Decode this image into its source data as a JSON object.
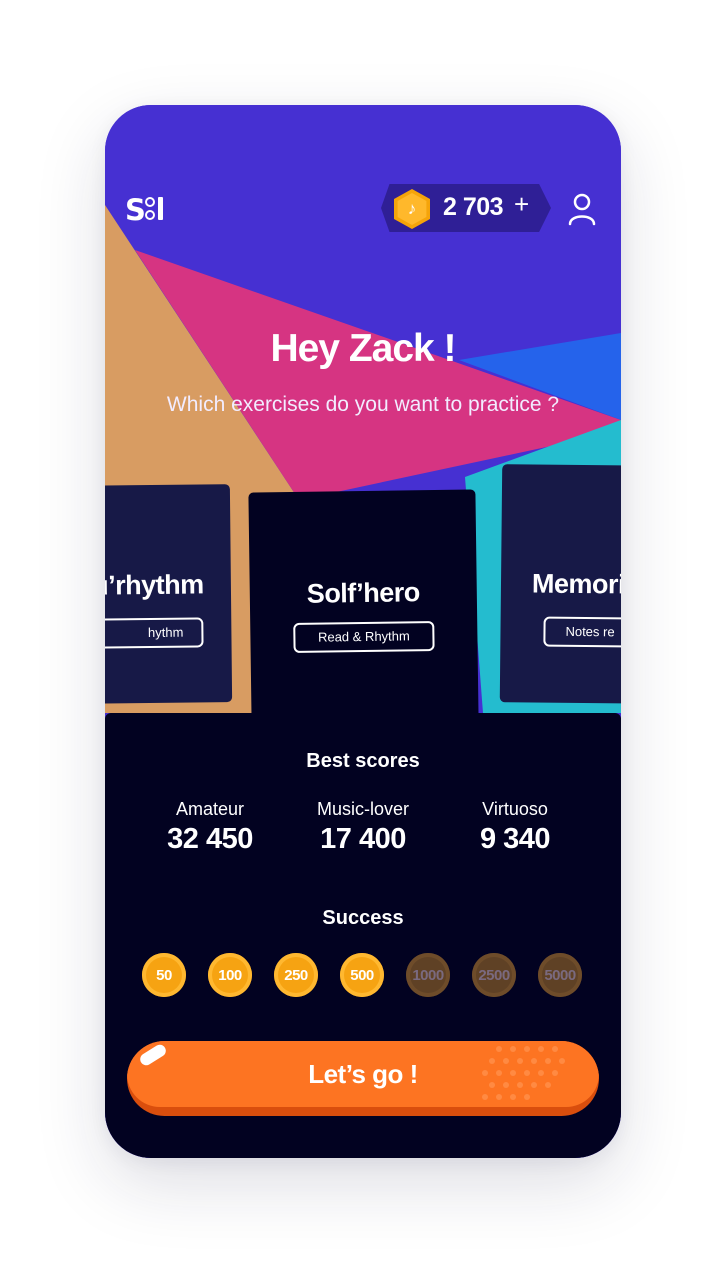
{
  "header": {
    "logo_text": "S",
    "coins": "2 703",
    "add_symbol": "+"
  },
  "greeting": "Hey Zack !",
  "subtitle": "Which exercises do you want to practice ?",
  "cards": [
    {
      "title": "ou’rhythm",
      "tag": "hythm"
    },
    {
      "title": "Solf’hero",
      "tag": "Read & Rhythm"
    },
    {
      "title": "Memori",
      "tag": "Notes re"
    }
  ],
  "best_scores": {
    "title": "Best scores",
    "items": [
      {
        "label": "Amateur",
        "value": "32 450"
      },
      {
        "label": "Music-lover",
        "value": "17 400"
      },
      {
        "label": "Virtuoso",
        "value": "9 340"
      }
    ]
  },
  "success": {
    "title": "Success",
    "badges": [
      {
        "label": "50",
        "unlocked": true
      },
      {
        "label": "100",
        "unlocked": true
      },
      {
        "label": "250",
        "unlocked": true
      },
      {
        "label": "500",
        "unlocked": true
      },
      {
        "label": "1000",
        "unlocked": false
      },
      {
        "label": "2500",
        "unlocked": false
      },
      {
        "label": "5000",
        "unlocked": false
      }
    ]
  },
  "cta": {
    "label": "Let’s go !"
  },
  "colors": {
    "purple": "#4630d2",
    "tan": "#d89c62",
    "pink": "#d63482",
    "blue": "#2563eb",
    "teal": "#24bccf",
    "navy": "#020221",
    "orange": "#fd7422",
    "gold": "#f6a312"
  },
  "icons": [
    "sol-logo",
    "music-note-coin-icon",
    "plus-icon",
    "user-icon"
  ]
}
